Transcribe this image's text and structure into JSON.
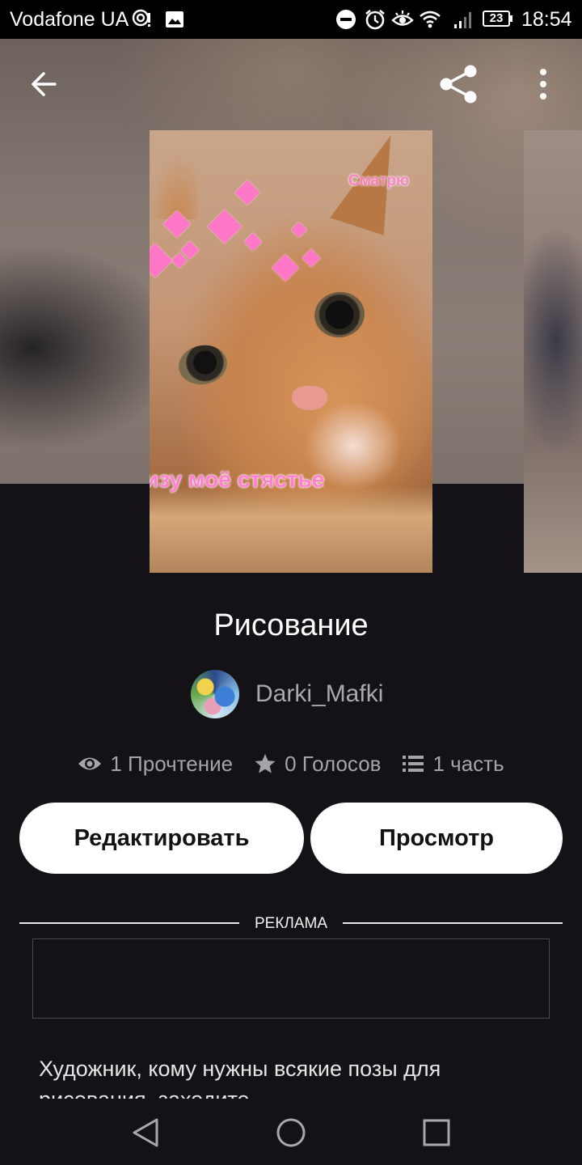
{
  "status_bar": {
    "carrier": "Vodafone UA",
    "battery": "23",
    "time": "18:54"
  },
  "cover": {
    "top_text": "Сматрю",
    "bottom_text": "изу моё стястье"
  },
  "story": {
    "title": "Рисование",
    "author": "Darki_Mafki",
    "reads": "1 Прочтение",
    "votes": "0 Голосов",
    "parts": "1 часть"
  },
  "actions": {
    "edit_label": "Редактировать",
    "view_label": "Просмотр"
  },
  "ad": {
    "label": "РЕКЛАМА"
  },
  "description": "Художник, кому нужны всякие позы для рисования, заходите",
  "icons": {
    "back": "arrow-left-icon",
    "share": "share-icon",
    "more": "more-vert-icon",
    "reads": "eye-icon",
    "votes": "star-icon",
    "parts": "list-icon",
    "nav_back": "triangle-back-icon",
    "nav_home": "circle-home-icon",
    "nav_recent": "square-recent-icon"
  },
  "colors": {
    "background": "#141216",
    "button_bg": "#ffffff",
    "secondary_text": "#a6a4a9",
    "cover_text_pink": "#ff7fd3"
  }
}
